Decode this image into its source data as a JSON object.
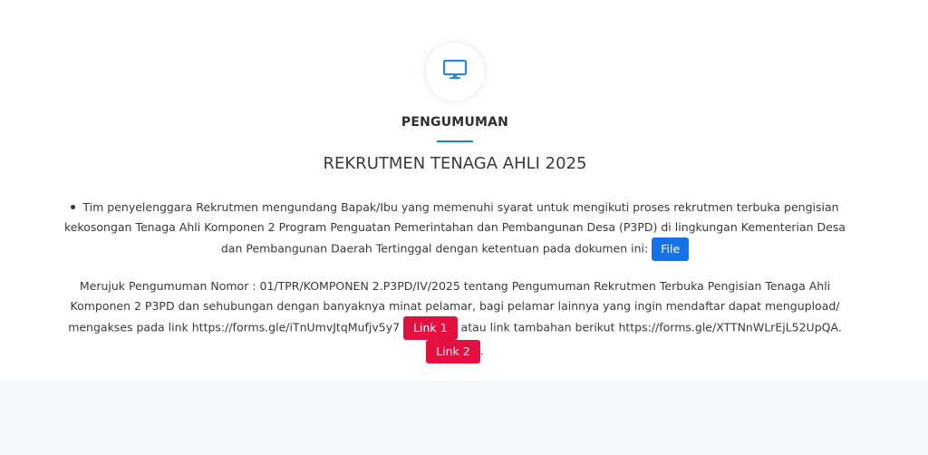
{
  "section": {
    "icon": "monitor-icon",
    "heading": "PENGUMUMAN",
    "title": "REKRUTMEN TENAGA AHLI 2025",
    "accent_color": "#1f7ee0"
  },
  "announcement": {
    "bullet_text": "Tim penyelenggara Rekrutmen mengundang Bapak/Ibu yang memenuhi syarat untuk mengikuti proses rekrutmen terbuka pengisian kekosongan Tenaga Ahli Komponen 2 Program Penguatan Pemerintahan dan Pembangunan Desa (P3PD) di lingkungan Kementerian Desa dan Pembangunan Daerah Tertinggal dengan ketentuan pada dokumen ini:",
    "file_button": "File",
    "file_button_color": "#1372e8"
  },
  "paragraph": {
    "text_before_link1": "Merujuk Pengumuman Nomor : 01/TPR/KOMPONEN 2.P3PD/IV/2025 tentang Pengumuman Rekrutmen Terbuka Pengisian Tenaga Ahli Komponen 2 P3PD dan sehubungan dengan banyaknya minat pelamar, bagi pelamar lainnya yang ingin mendaftar dapat mengupload/ mengakses pada link https://forms.gle/iTnUmvJtqMufjv5y7",
    "link1_button": "Link 1",
    "text_between": "atau link tambahan berikut https://forms.gle/XTTNnWLrEjL52UpQA.",
    "link2_button": "Link 2",
    "text_end": ".",
    "link_button_color": "#e4103f"
  }
}
